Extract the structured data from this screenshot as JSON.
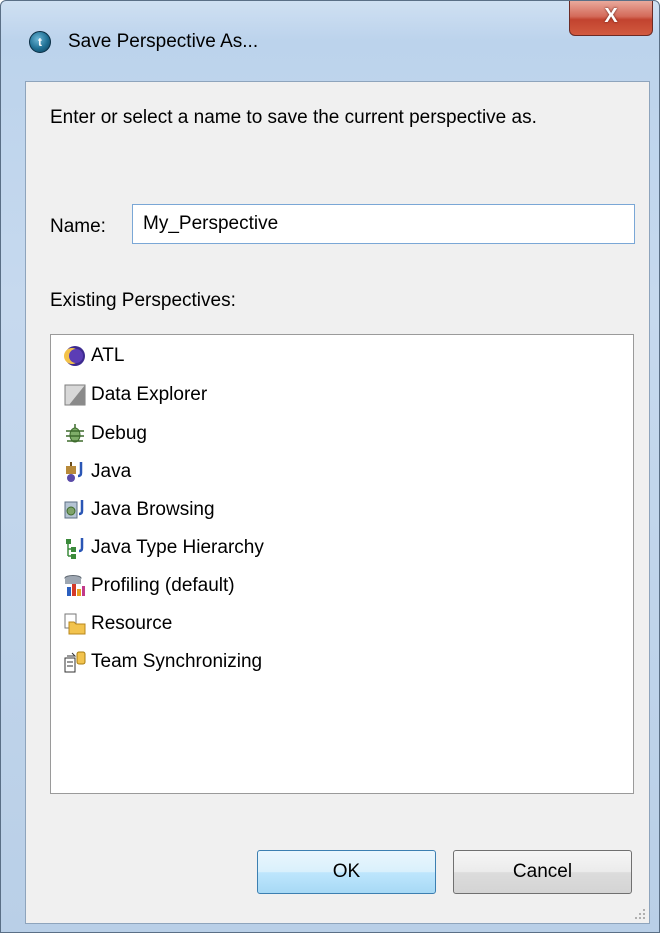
{
  "window": {
    "title": "Save Perspective As...",
    "app_icon_glyph": "t",
    "close_glyph": "X"
  },
  "dialog": {
    "description": "Enter or select a name to save the current perspective as.",
    "name_label": "Name:",
    "name_value": "My_Perspective",
    "existing_label": "Existing Perspectives:",
    "perspectives": [
      {
        "label": "ATL",
        "icon": "atl-icon"
      },
      {
        "label": "Data Explorer",
        "icon": "data-explorer-icon"
      },
      {
        "label": "Debug",
        "icon": "debug-icon"
      },
      {
        "label": "Java",
        "icon": "java-icon"
      },
      {
        "label": "Java Browsing",
        "icon": "java-browsing-icon"
      },
      {
        "label": "Java Type Hierarchy",
        "icon": "java-type-hierarchy-icon"
      },
      {
        "label": "Profiling (default)",
        "icon": "profiling-icon"
      },
      {
        "label": "Resource",
        "icon": "resource-icon"
      },
      {
        "label": "Team Synchronizing",
        "icon": "team-synchronizing-icon"
      }
    ],
    "ok_label": "OK",
    "cancel_label": "Cancel"
  },
  "colors": {
    "frame": "#bcd3ec",
    "client": "#f0f0f0",
    "close_red": "#c2432f",
    "ok_border": "#3c7fb1"
  }
}
